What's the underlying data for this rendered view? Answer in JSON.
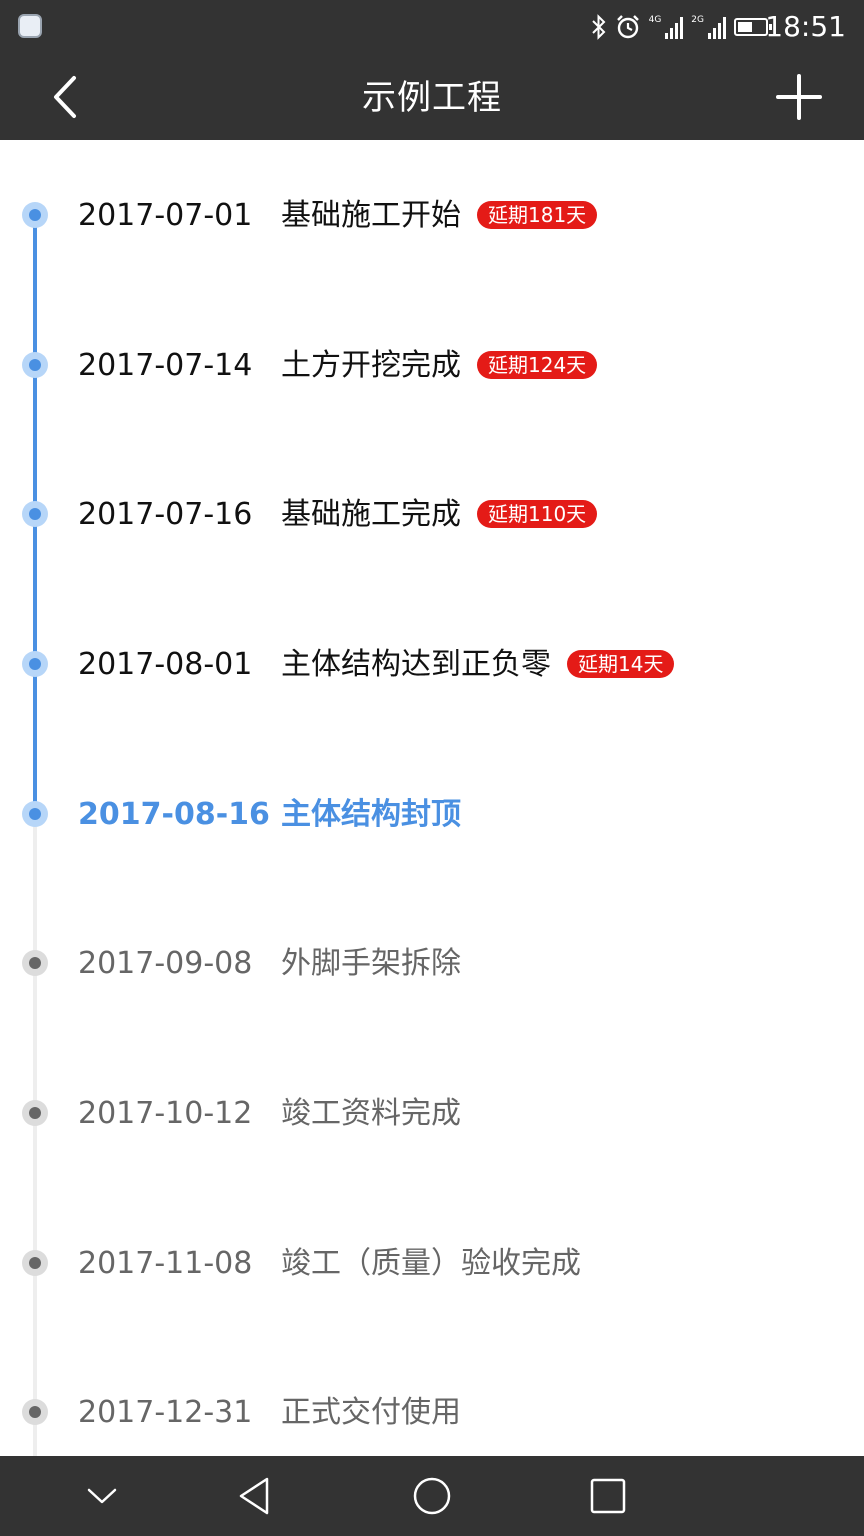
{
  "status_bar": {
    "time": "18:51",
    "network_1": "4G",
    "network_2": "2G",
    "icons": [
      "bluetooth-icon",
      "alarm-icon",
      "signal-icon",
      "battery-icon"
    ]
  },
  "header": {
    "title": "示例工程",
    "back_icon": "chevron-left-icon",
    "add_icon": "plus-icon"
  },
  "colors": {
    "bar": "#333333",
    "accent": "#4a90e2",
    "delay_badge": "#e41b17",
    "future_text": "#666666"
  },
  "milestones": [
    {
      "date": "2017-07-01",
      "name": "基础施工开始",
      "delay": "延期181天",
      "state": "done"
    },
    {
      "date": "2017-07-14",
      "name": "土方开挖完成",
      "delay": "延期124天",
      "state": "done"
    },
    {
      "date": "2017-07-16",
      "name": "基础施工完成",
      "delay": "延期110天",
      "state": "done"
    },
    {
      "date": "2017-08-01",
      "name": "主体结构达到正负零",
      "delay": "延期14天",
      "state": "done"
    },
    {
      "date": "2017-08-16",
      "name": "主体结构封顶",
      "delay": "",
      "state": "current"
    },
    {
      "date": "2017-09-08",
      "name": "外脚手架拆除",
      "delay": "",
      "state": "future"
    },
    {
      "date": "2017-10-12",
      "name": "竣工资料完成",
      "delay": "",
      "state": "future"
    },
    {
      "date": "2017-11-08",
      "name": "竣工（质量）验收完成",
      "delay": "",
      "state": "future"
    },
    {
      "date": "2017-12-31",
      "name": "正式交付使用",
      "delay": "",
      "state": "future"
    }
  ],
  "nav_bar": {
    "buttons": [
      "chevron-down-icon",
      "back-triangle-icon",
      "home-circle-icon",
      "recents-square-icon"
    ]
  }
}
